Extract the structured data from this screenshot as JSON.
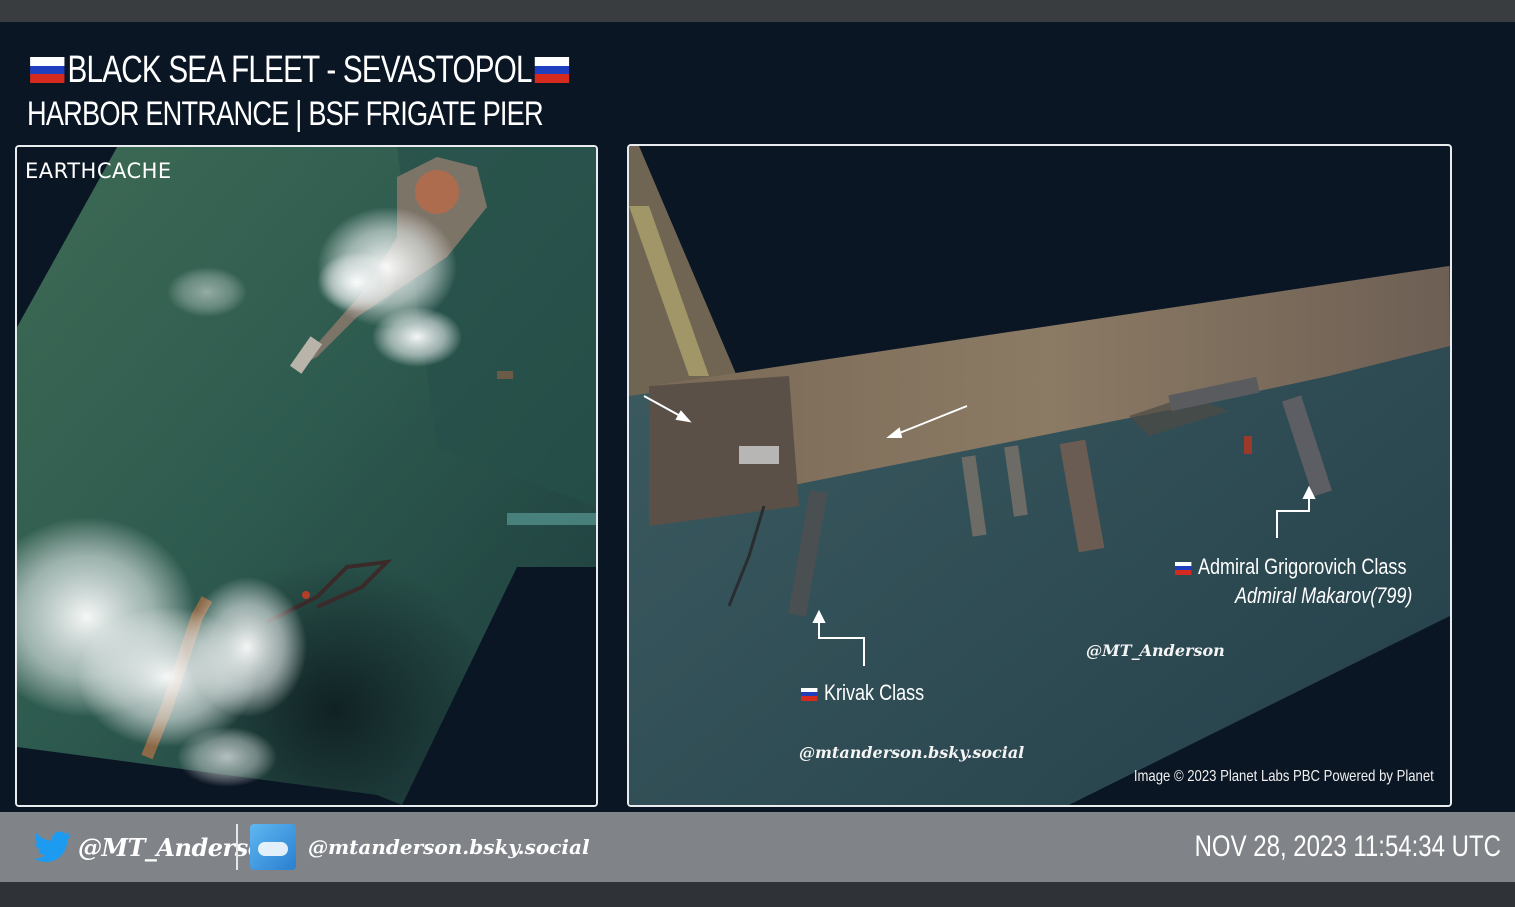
{
  "header": {
    "title": "BLACK SEA FLEET -  SEVASTOPOL",
    "subtitle": "HARBOR ENTRANCE | BSF FRIGATE PIER"
  },
  "left_panel": {
    "logo": "EARTHCACHE",
    "icons": [
      "russia-flag"
    ]
  },
  "right_panel": {
    "labels": [
      {
        "class_name": "Admiral Grigorovich Class",
        "ship_name": "Admiral Makarov(799)"
      },
      {
        "class_name": "Krivak Class"
      }
    ],
    "watermark_x": "@MT_Anderson",
    "watermark_bsky": "@mtanderson.bsky.social",
    "credit": "Image © 2023 Planet Labs PBC Powered by Planet"
  },
  "footer": {
    "twitter_handle": "@MT_Anderson",
    "bsky_handle": "@mtanderson.bsky.social",
    "timestamp": "NOV 28, 2023 11:54:34 UTC"
  },
  "colors": {
    "background": "#0b1624",
    "footer_bar": "#808489",
    "flag_white": "#ffffff",
    "flag_blue": "#1f3fbf",
    "flag_red": "#d52b1e",
    "twitter_blue": "#1d9bf0"
  }
}
